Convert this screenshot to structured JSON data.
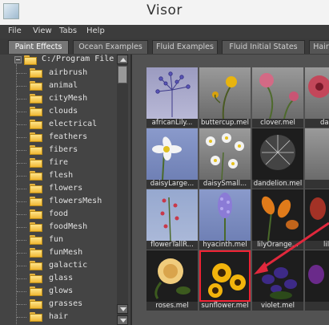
{
  "window": {
    "title": "Visor"
  },
  "menu": [
    "File",
    "View",
    "Tabs",
    "Help"
  ],
  "tabs": [
    {
      "label": "Paint Effects",
      "active": true
    },
    {
      "label": "Ocean Examples",
      "active": false
    },
    {
      "label": "Fluid Examples",
      "active": false
    },
    {
      "label": "Fluid Initial States",
      "active": false
    },
    {
      "label": "Hair",
      "active": false
    }
  ],
  "tree": {
    "root": "C:/Program File",
    "items": [
      "airbrush",
      "animal",
      "cityMesh",
      "clouds",
      "electrical",
      "feathers",
      "fibers",
      "fire",
      "flesh",
      "flowers",
      "flowersMesh",
      "food",
      "foodMesh",
      "fun",
      "funMesh",
      "galactic",
      "glass",
      "glows",
      "grasses",
      "hair"
    ]
  },
  "gallery": [
    {
      "label": "africanLily...",
      "icon": "african-lily-thumbnail"
    },
    {
      "label": "buttercup.mel",
      "icon": "buttercup-thumbnail"
    },
    {
      "label": "clover.mel",
      "icon": "clover-thumbnail"
    },
    {
      "label": "dahlia",
      "icon": "dahlia-thumbnail"
    },
    {
      "label": "daisyLarge...",
      "icon": "daisy-large-thumbnail"
    },
    {
      "label": "daisySmall...",
      "icon": "daisy-small-thumbnail"
    },
    {
      "label": "dandelion.mel",
      "icon": "dandelion-thumbnail"
    },
    {
      "label": "",
      "icon": "blank-thumbnail"
    },
    {
      "label": "flowerTallR...",
      "icon": "flower-tall-thumbnail"
    },
    {
      "label": "hyacinth.mel",
      "icon": "hyacinth-thumbnail"
    },
    {
      "label": "lilyOrange...",
      "icon": "lily-orange-thumbnail"
    },
    {
      "label": "lilyR",
      "icon": "lily-red-thumbnail"
    },
    {
      "label": "roses.mel",
      "icon": "roses-thumbnail"
    },
    {
      "label": "sunflower.mel",
      "icon": "sunflower-thumbnail",
      "selected": true
    },
    {
      "label": "violet.mel",
      "icon": "violet-thumbnail"
    },
    {
      "label": "",
      "icon": "partial-thumbnail"
    }
  ],
  "colors": {
    "selection": "#e22233",
    "annotation_arrow": "#e0283c",
    "folder": "#f0b834"
  }
}
